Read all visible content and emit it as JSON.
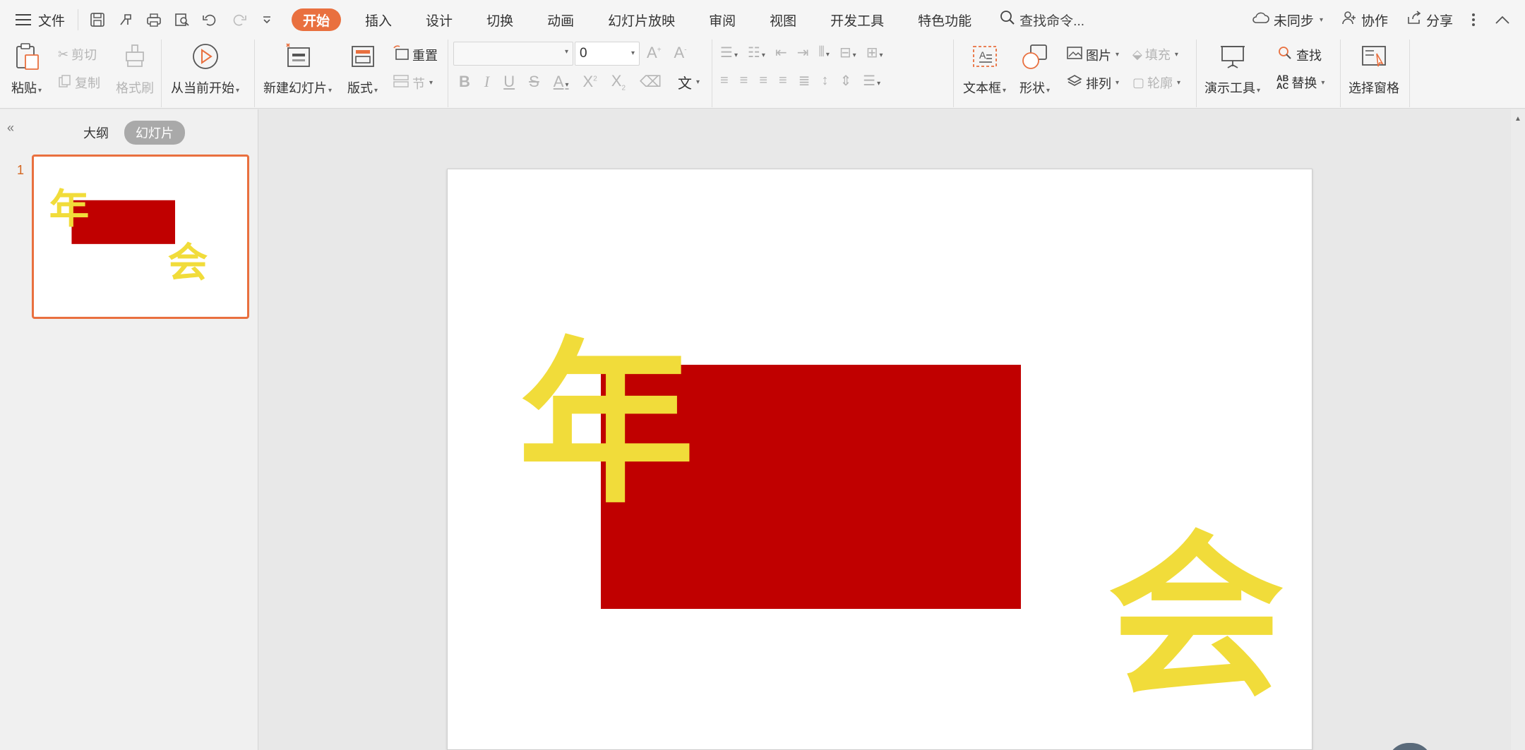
{
  "menu": {
    "file_label": "文件",
    "tabs": [
      "开始",
      "插入",
      "设计",
      "切换",
      "动画",
      "幻灯片放映",
      "审阅",
      "视图",
      "开发工具",
      "特色功能"
    ],
    "search_label": "查找命令...",
    "sync_label": "未同步",
    "collab_label": "协作",
    "share_label": "分享"
  },
  "ribbon": {
    "paste": "粘贴",
    "cut": "剪切",
    "copy": "复制",
    "format_painter": "格式刷",
    "play_from_current": "从当前开始",
    "new_slide": "新建幻灯片",
    "layout": "版式",
    "reset": "重置",
    "section": "节",
    "font_size": "0",
    "text_box": "文本框",
    "shape": "形状",
    "picture": "图片",
    "fill": "填充",
    "arrange": "排列",
    "outline": "轮廓",
    "presentation_tools": "演示工具",
    "find": "查找",
    "replace": "替换",
    "selection_pane": "选择窗格",
    "phonetic": "文"
  },
  "panel": {
    "outline_tab": "大纲",
    "slides_tab": "幻灯片",
    "slide_number": "1"
  },
  "slide": {
    "char_year": "年",
    "char_meeting": "会",
    "colors": {
      "rect": "#c00000",
      "calligraphy": "#f1dc3a"
    }
  }
}
